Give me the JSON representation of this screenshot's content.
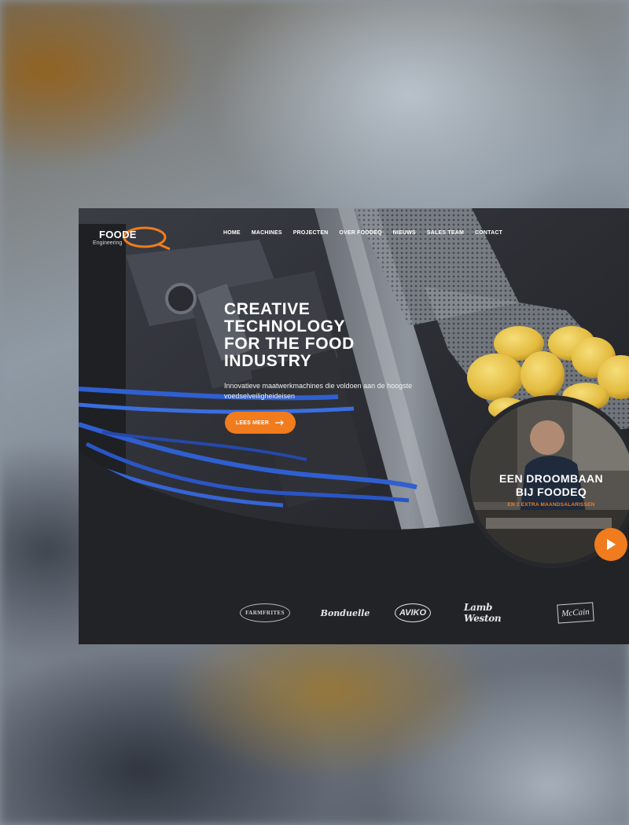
{
  "site": {
    "logo": {
      "word": "FOODE",
      "word_accent": "Q",
      "sub": "Engineering"
    },
    "nav": [
      {
        "label": "HOME"
      },
      {
        "label": "MACHINES"
      },
      {
        "label": "PROJECTEN"
      },
      {
        "label": "OVER FOODEQ"
      },
      {
        "label": "NIEUWS"
      },
      {
        "label": "SALES TEAM"
      },
      {
        "label": "CONTACT"
      }
    ],
    "hero": {
      "headline": [
        "CREATIVE",
        "TECHNOLOGY",
        "FOR THE FOOD",
        "INDUSTRY"
      ],
      "subtext": "Innovatieve maatwerkmachines die voldoen aan de hoogste voedselveiligheideisen",
      "cta_label": "LEES MEER",
      "cta_icon": "arrow-right-icon"
    },
    "job_promo": {
      "title_lines": [
        "EEN DROOMBAAN",
        "BIJ FOODEQ"
      ],
      "subtitle": "EN 2 EXTRA MAANDSALARISSEN",
      "play_icon": "play-icon"
    },
    "clients": [
      "FARMFRITES",
      "Bonduelle",
      "AVIKO",
      "Lamb Weston",
      "McCain"
    ]
  },
  "colors": {
    "accent": "#f07c1e",
    "dark_bg": "#222326",
    "text": "#ffffff",
    "cable_blue": "#2f5fd0",
    "potato_yellow": "#e8c24a"
  }
}
